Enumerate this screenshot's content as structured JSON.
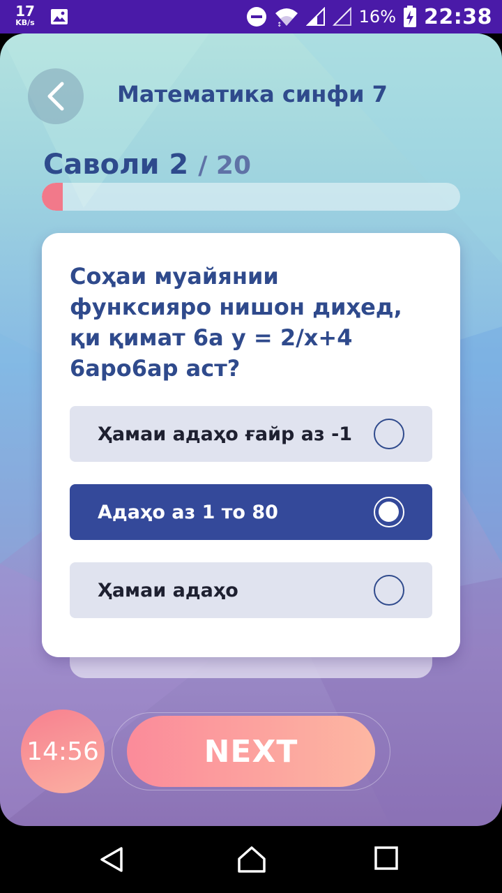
{
  "status_bar": {
    "net_speed": "17",
    "net_unit": "KB/s",
    "battery_percent": "16%",
    "time": "22:38"
  },
  "header": {
    "back_icon": "chevron-left-icon",
    "title": "Математика синфи 7"
  },
  "progress": {
    "question_label": "Саволи 2",
    "total_label": "/ 20",
    "current": 2,
    "total": 20,
    "fill_fraction": 0.05
  },
  "question": {
    "text": "Соҳаи муайянии функсияро нишон диҳед, қи қимат 6а у = 2/х+4 6аро6ар аст?",
    "options": [
      {
        "label": "Ҳамаи адаҳо ғайр аз -1",
        "selected": false
      },
      {
        "label": "Адаҳо аз 1 то 80",
        "selected": true
      },
      {
        "label": "Ҳамаи адаҳо",
        "selected": false
      }
    ]
  },
  "footer": {
    "timer": "14:56",
    "next_label": "NEXT"
  },
  "colors": {
    "accent": "#34499a",
    "title": "#2f4a8c",
    "progress_fill": "#f2798a",
    "next_gradient_start": "#fb8b9a",
    "next_gradient_end": "#fdb7a2"
  }
}
